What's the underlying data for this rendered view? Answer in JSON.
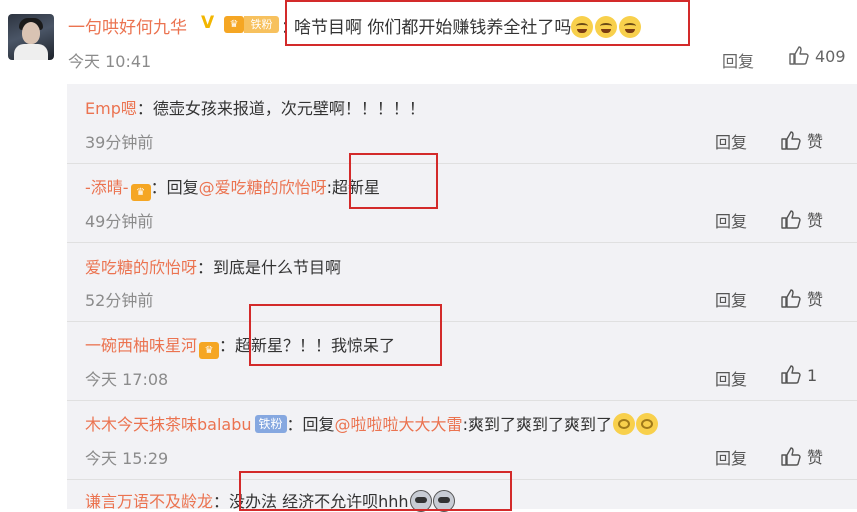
{
  "main_comment": {
    "username": "一句哄好何九华",
    "verified_mark": "V",
    "fan_badge_label": "铁粉",
    "colon": "：",
    "text": "啥节目啊 你们都开始赚钱养全社了吗",
    "emoji_count": 3,
    "time": "今天 10:41",
    "reply_label": "回复",
    "like_count": "409"
  },
  "replies": [
    {
      "name": "Emp嗯",
      "segments": [
        {
          "t": "：德壶女孩来报道，次元壁啊！！！！！"
        }
      ],
      "time": "39分钟前",
      "reply_label": "回复",
      "like_label": "赞"
    },
    {
      "name": "-添晴-",
      "segments": [
        {
          "t": "：回复"
        },
        {
          "t": "@爱吃糖的欣怡呀",
          "mention": true
        },
        {
          "t": ":超新星"
        }
      ],
      "time": "49分钟前",
      "reply_label": "回复",
      "like_label": "赞"
    },
    {
      "name": "爱吃糖的欣怡呀",
      "segments": [
        {
          "t": "：到底是什么节目啊"
        }
      ],
      "time": "52分钟前",
      "reply_label": "回复",
      "like_label": "赞"
    },
    {
      "name": "一碗西柚味星河",
      "segments": [
        {
          "t": "：超新星？！！我惊呆了"
        }
      ],
      "time": "今天 17:08",
      "reply_label": "回复",
      "like_label": "1"
    },
    {
      "name": "木木今天抹茶味balabu",
      "badge": "铁粉",
      "segments": [
        {
          "t": "：回复"
        },
        {
          "t": "@啦啦啦大大大雷",
          "mention": true
        },
        {
          "t": ":爽到了爽到了爽到了"
        }
      ],
      "time": "今天 15:29",
      "reply_label": "回复",
      "like_label": "赞"
    },
    {
      "name": "谦言万语不及龄龙",
      "segments": [
        {
          "t": "：没办法  经济不允许呗hhh"
        }
      ],
      "time": "",
      "reply_label": "",
      "like_label": ""
    }
  ],
  "colors": {
    "username": "#eb7350",
    "highlight_box": "#d32a2a",
    "reply_bg": "#f2f2f5",
    "time": "#8b8b8b"
  }
}
